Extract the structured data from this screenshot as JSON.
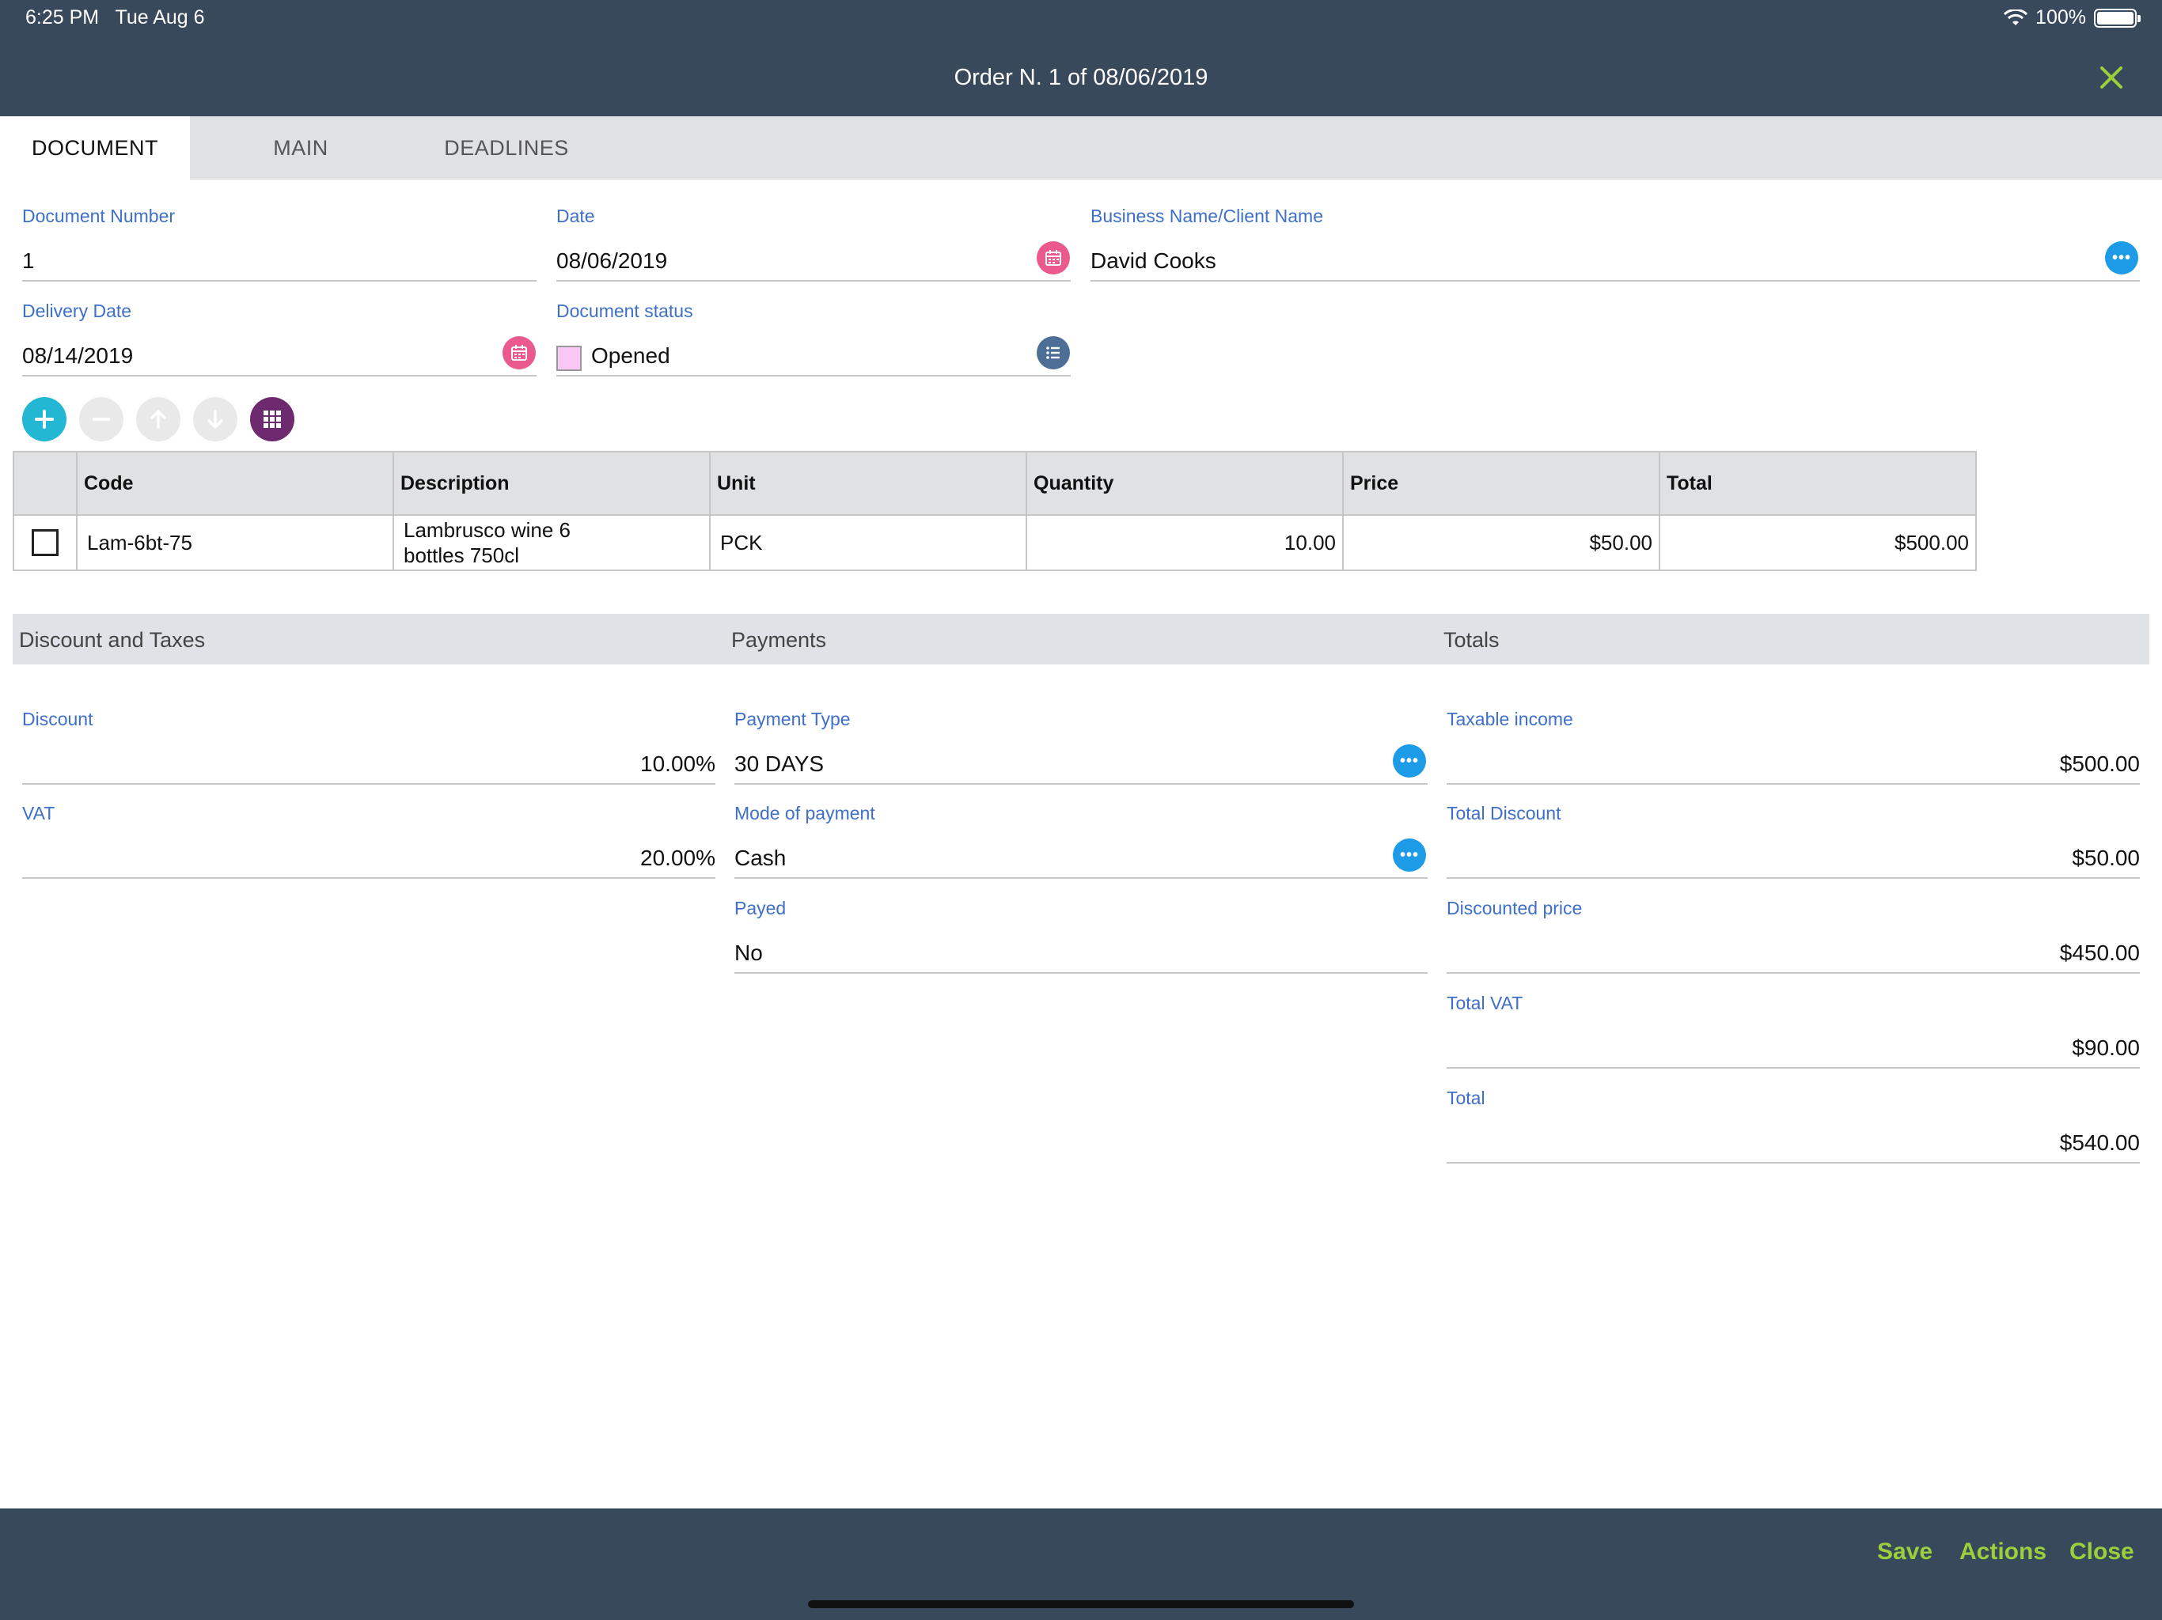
{
  "status": {
    "time": "6:25 PM",
    "date": "Tue Aug 6",
    "battery": "100%"
  },
  "header": {
    "title": "Order N. 1 of 08/06/2019"
  },
  "tabs": [
    {
      "label": "DOCUMENT",
      "active": true
    },
    {
      "label": "MAIN",
      "active": false
    },
    {
      "label": "DEADLINES",
      "active": false
    }
  ],
  "form": {
    "document_number": {
      "label": "Document Number",
      "value": "1"
    },
    "date": {
      "label": "Date",
      "value": "08/06/2019"
    },
    "client": {
      "label": "Business Name/Client Name",
      "value": "David Cooks"
    },
    "delivery_date": {
      "label": "Delivery Date",
      "value": "08/14/2019"
    },
    "status": {
      "label": "Document status",
      "value": "Opened",
      "color": "#f9c6f5"
    }
  },
  "table": {
    "columns": [
      "Code",
      "Description",
      "Unit",
      "Quantity",
      "Price",
      "Total"
    ],
    "rows": [
      {
        "code": "Lam-6bt-75",
        "description_line1": "Lambrusco wine 6",
        "description_line2": "bottles 750cl",
        "unit": "PCK",
        "quantity": "10.00",
        "price": "$50.00",
        "total": "$500.00"
      }
    ]
  },
  "sections": {
    "discount": "Discount and Taxes",
    "payments": "Payments",
    "totals": "Totals"
  },
  "discount_taxes": {
    "discount": {
      "label": "Discount",
      "value": "10.00%"
    },
    "vat": {
      "label": "VAT",
      "value": "20.00%"
    }
  },
  "payments": {
    "type": {
      "label": "Payment Type",
      "value": "30 DAYS"
    },
    "mode": {
      "label": "Mode of payment",
      "value": "Cash"
    },
    "payed": {
      "label": "Payed",
      "value": "No"
    }
  },
  "totals": {
    "taxable": {
      "label": "Taxable income",
      "value": "$500.00"
    },
    "total_discount": {
      "label": "Total Discount",
      "value": "$50.00"
    },
    "discounted": {
      "label": "Discounted price",
      "value": "$450.00"
    },
    "total_vat": {
      "label": "Total VAT",
      "value": "$90.00"
    },
    "total": {
      "label": "Total",
      "value": "$540.00"
    }
  },
  "footer": {
    "save": "Save",
    "actions": "Actions",
    "close": "Close"
  },
  "colors": {
    "header_bg": "#38495c",
    "label_blue": "#3e6fc9",
    "accent_green": "#9bcf3c",
    "calendar_pink": "#ea5a8c",
    "dots_blue": "#1d9be6",
    "list_slate": "#4d6f96",
    "add_teal": "#23b7d3",
    "grid_purple": "#6d2a6e"
  }
}
